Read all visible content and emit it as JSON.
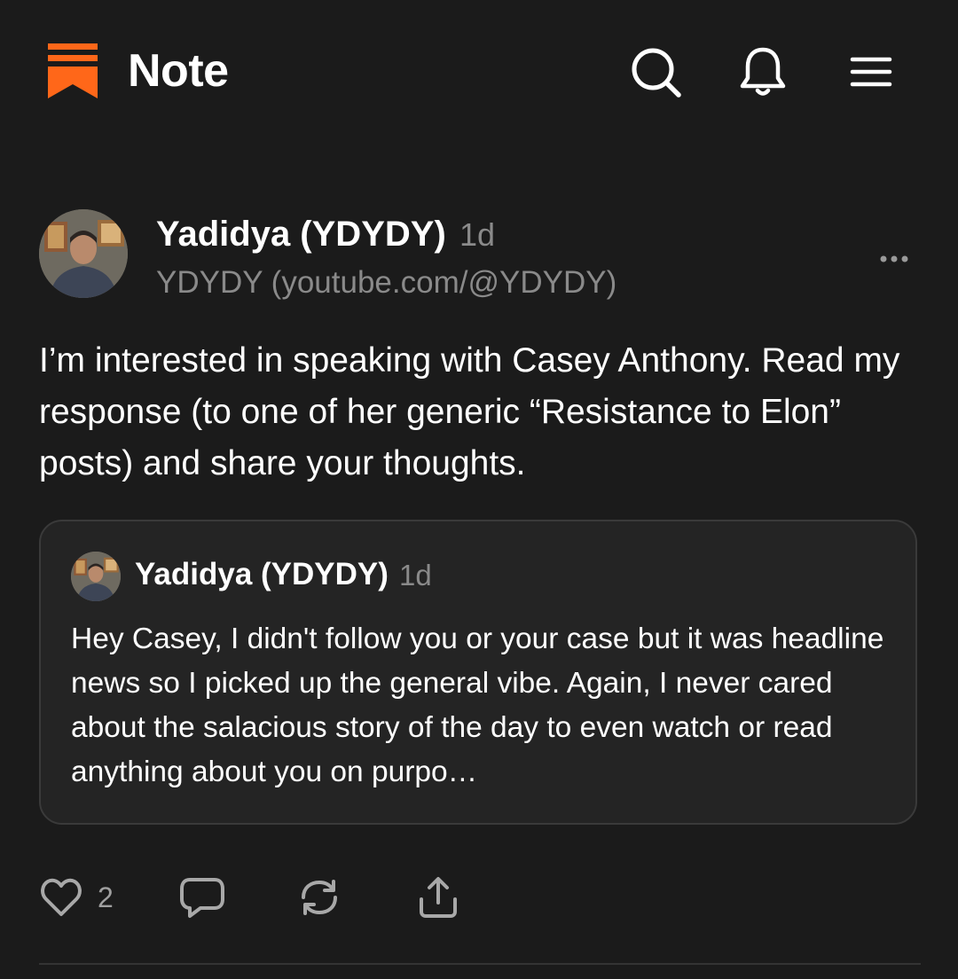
{
  "header": {
    "title": "Note",
    "brand_color": "#ff6719",
    "icons": [
      "search-icon",
      "bell-icon",
      "menu-icon"
    ]
  },
  "post": {
    "author_name": "Yadidya (YDYDY)",
    "time": "1d",
    "handle": "YDYDY (youtube.com/@YDYDY)",
    "body": "I’m interested in speaking with Casey Anthony. Read my response (to one of her generic “Resistance to Elon” posts) and share your thoughts.",
    "more_icon": "more-horizontal-icon"
  },
  "quote": {
    "author_name": "Yadidya (YDYDY)",
    "time": "1d",
    "body": "Hey Casey, I didn't follow you or your case but it was headline news so I picked up the general vibe. Again, I never cared about the salacious story of the day to even watch or read anything about you on purpo…"
  },
  "actions": {
    "like_count": "2",
    "icons": [
      "heart-icon",
      "comment-icon",
      "restack-icon",
      "share-icon"
    ]
  },
  "colors": {
    "background": "#1b1b1b",
    "card": "#242424",
    "muted_text": "#8a8a8a"
  }
}
